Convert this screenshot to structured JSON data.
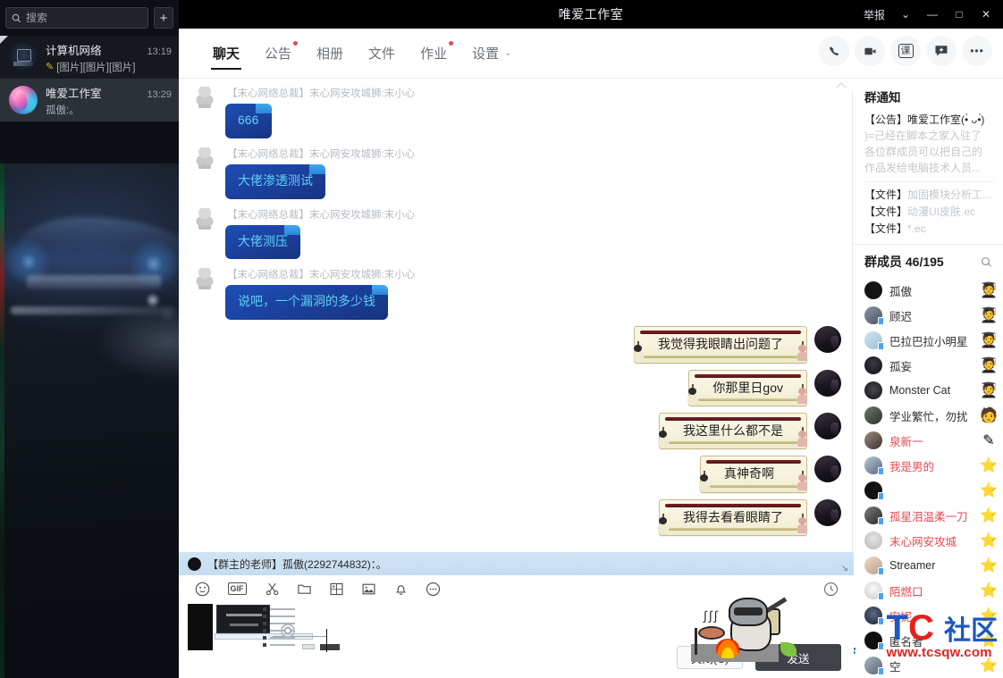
{
  "window": {
    "title": "唯爱工作室",
    "report_label": "举报",
    "chevron": "⌄",
    "minimize": "—",
    "maximize": "□",
    "close": "✕"
  },
  "sidebar": {
    "search": {
      "placeholder": "搜索",
      "value": "",
      "icon": "search-icon"
    },
    "add_button": "+",
    "chats": [
      {
        "name": "计算机网络",
        "time": "13:19",
        "snippet": "[图片][图片][图片]",
        "draft_icon": "pencil-icon"
      },
      {
        "name": "唯爱工作室",
        "time": "13:29",
        "snippet": "孤傲:。",
        "draft_icon": ""
      }
    ]
  },
  "tabs": [
    {
      "label": "聊天",
      "active": true,
      "dot": false
    },
    {
      "label": "公告",
      "active": false,
      "dot": true
    },
    {
      "label": "相册",
      "active": false,
      "dot": false
    },
    {
      "label": "文件",
      "active": false,
      "dot": false
    },
    {
      "label": "作业",
      "active": false,
      "dot": true
    },
    {
      "label": "设置",
      "active": false,
      "dot": false,
      "chevron": "⌄"
    }
  ],
  "header_actions": [
    {
      "name": "phone-icon",
      "glyph": "📞"
    },
    {
      "name": "video-call-icon",
      "glyph": "🎥"
    },
    {
      "name": "class-icon",
      "glyph": "课"
    },
    {
      "name": "add-chat-icon",
      "glyph": "＋"
    },
    {
      "name": "more-icon",
      "glyph": "•••"
    }
  ],
  "messages": [
    {
      "side": "other",
      "sender": "【末心网络总裁】末心网安攻城狮:末小心",
      "text": "666"
    },
    {
      "side": "other",
      "sender": "【末心网络总裁】末心网安攻城狮:末小心",
      "text": "大佬渗透测试"
    },
    {
      "side": "other",
      "sender": "【末心网络总裁】末心网安攻城狮:末小心",
      "text": "大佬测压"
    },
    {
      "side": "other",
      "sender": "【末心网络总裁】末心网安攻城狮:末小心",
      "text": "说吧，一个漏洞的多少钱"
    },
    {
      "side": "me",
      "sender": "",
      "text": "我觉得我眼睛出问题了"
    },
    {
      "side": "me",
      "sender": "",
      "text": "你那里日gov"
    },
    {
      "side": "me",
      "sender": "",
      "text": "我这里什么都不是"
    },
    {
      "side": "me",
      "sender": "",
      "text": "真神奇啊"
    },
    {
      "side": "me",
      "sender": "",
      "text": "我得去看看眼睛了"
    }
  ],
  "input": {
    "quote": "【群主的老师】孤傲(2292744832)：。",
    "tools": [
      {
        "name": "emoji-icon",
        "glyph": "☺"
      },
      {
        "name": "gif-icon",
        "glyph": "GIF"
      },
      {
        "name": "screenshot-scissors-icon",
        "glyph": "✂"
      },
      {
        "name": "folder-icon",
        "glyph": "🗀"
      },
      {
        "name": "card-icon",
        "glyph": "▦"
      },
      {
        "name": "image-icon",
        "glyph": "🖼"
      },
      {
        "name": "bell-icon",
        "glyph": "🔔"
      },
      {
        "name": "more-tools-icon",
        "glyph": "•••"
      }
    ],
    "history_icon": "clock-icon",
    "close_button": "关闭(C)",
    "send_button": "发送"
  },
  "right_panel": {
    "notice_title": "群通知",
    "notice_lines": [
      "【公告】唯爱工作室(•̀ ᴗ•́)",
      ")=己经在脚本之家入驻了",
      "各位群成员可以把自己的",
      "作品发给电脑技术人员..."
    ],
    "files": [
      {
        "tag": "【文件】",
        "name": "加固模块分析工..."
      },
      {
        "tag": "【文件】",
        "name": "动漫UI皮肤.ec"
      },
      {
        "tag": "【文件】",
        "name": "*.ec"
      }
    ],
    "members_title": "群成员",
    "members_count": "46/195",
    "search_icon": "search-icon",
    "members": [
      {
        "nick": "孤傲",
        "red": false,
        "badge": "star-person",
        "mobile": false
      },
      {
        "nick": "顾迟",
        "red": false,
        "badge": "star-person",
        "mobile": true
      },
      {
        "nick": "巴拉巴拉小明星",
        "red": false,
        "badge": "star-person",
        "mobile": true
      },
      {
        "nick": "孤妄",
        "red": false,
        "badge": "star-person",
        "mobile": false
      },
      {
        "nick": "Monster Cat",
        "red": false,
        "badge": "star-person",
        "mobile": false
      },
      {
        "nick": "学业繁忙，勿扰",
        "red": false,
        "badge": "person",
        "mobile": false
      },
      {
        "nick": "泉新一",
        "red": true,
        "badge": "pencil",
        "mobile": false
      },
      {
        "nick": "我是男的",
        "red": true,
        "badge": "star",
        "mobile": true
      },
      {
        "nick": "",
        "red": false,
        "badge": "star",
        "mobile": true
      },
      {
        "nick": "孤星泪温柔一刀",
        "red": true,
        "badge": "star",
        "mobile": true
      },
      {
        "nick": "末心网安攻城",
        "red": true,
        "badge": "star",
        "mobile": false
      },
      {
        "nick": "Streamer",
        "red": false,
        "badge": "star",
        "mobile": true
      },
      {
        "nick": "陌燃口",
        "red": true,
        "badge": "star",
        "mobile": true
      },
      {
        "nick": "安妮",
        "red": true,
        "badge": "star",
        "mobile": true
      },
      {
        "nick": "匿名者",
        "red": false,
        "badge": "star",
        "mobile": true
      },
      {
        "nick": "空",
        "red": false,
        "badge": "star",
        "mobile": true
      }
    ]
  },
  "watermark": {
    "tc_t": "T",
    "tc_c": "C",
    "sq": "社区",
    "url": "www.tcsqw.com"
  }
}
